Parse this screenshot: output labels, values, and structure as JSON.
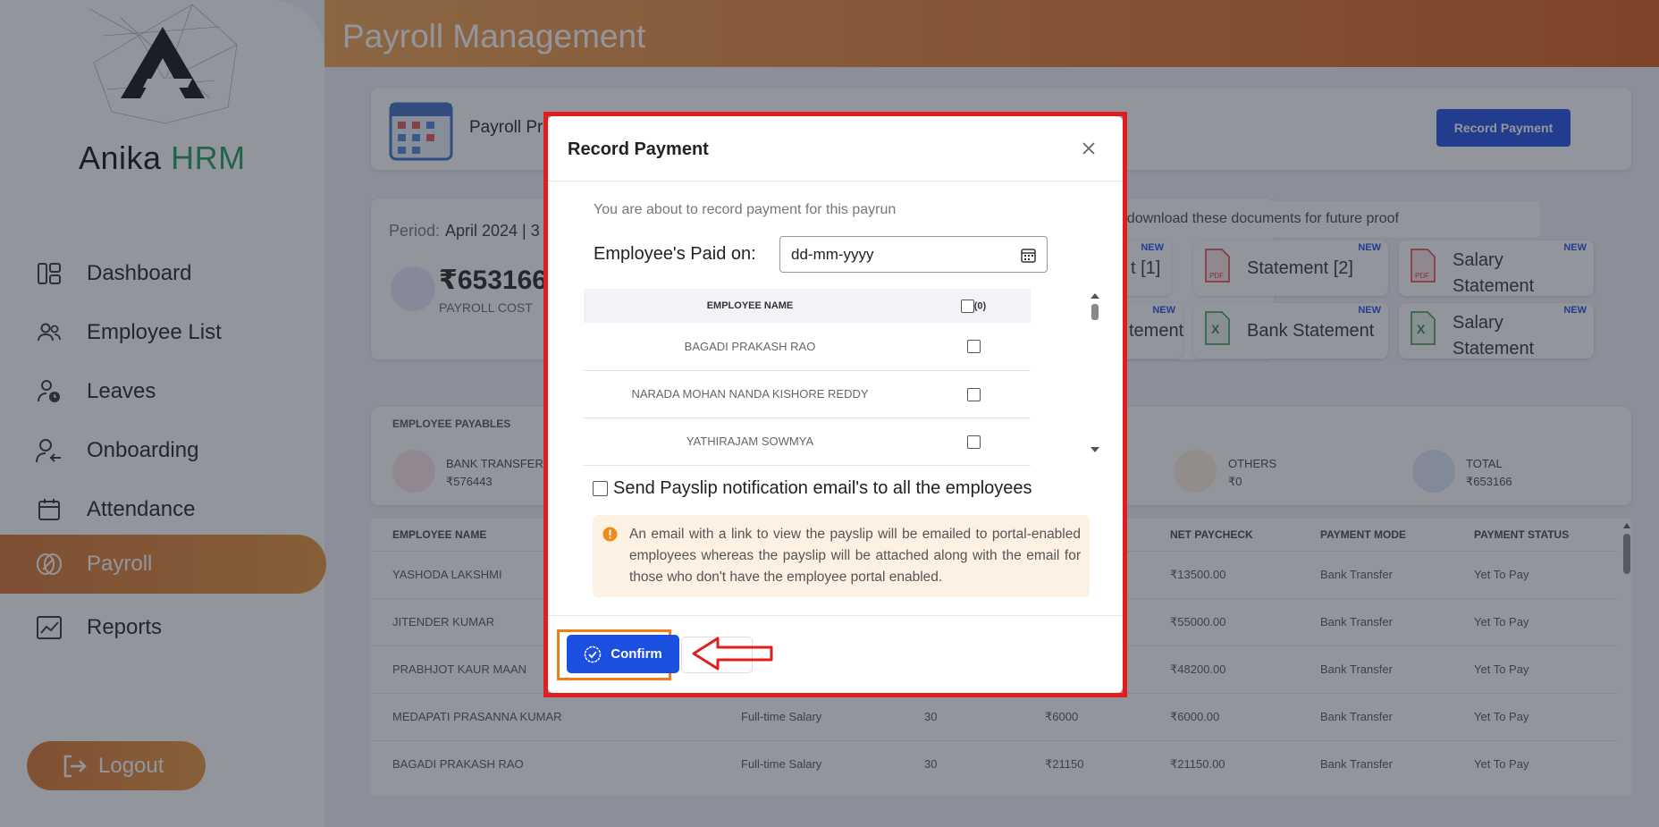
{
  "app": {
    "brand_part1": "Anika",
    "brand_part2": "HRM",
    "page_title": "Payroll Management"
  },
  "sidebar": {
    "items": [
      {
        "label": "Dashboard"
      },
      {
        "label": "Employee List"
      },
      {
        "label": "Leaves"
      },
      {
        "label": "Onboarding"
      },
      {
        "label": "Attendance"
      },
      {
        "label": "Payroll"
      },
      {
        "label": "Reports"
      }
    ],
    "logout": "Logout"
  },
  "payroll_header": {
    "label": "Payroll Pr",
    "record_payment": "Record Payment"
  },
  "period": {
    "text": "Period:",
    "value": "April 2024 | 3",
    "cost": "₹653166",
    "cost_label": "PAYROLL COST",
    "download_note": "l to download these documents for future proof"
  },
  "doc_tiles": [
    {
      "label": "t [1]",
      "new": "NEW"
    },
    {
      "label": "Statement [2]",
      "new": "NEW"
    },
    {
      "label": "Salary Statement",
      "new": "NEW"
    },
    {
      "label": "tement",
      "new": "NEW"
    },
    {
      "label": "Bank Statement",
      "new": "NEW"
    },
    {
      "label": "Salary Statement",
      "new": "NEW"
    }
  ],
  "payables": {
    "title": "EMPLOYEE PAYABLES",
    "bank_transfer": "BANK TRANSFER",
    "bank_transfer_value": "₹576443",
    "others": "OTHERS",
    "others_value": "₹0",
    "total": "TOTAL",
    "total_value": "₹653166"
  },
  "table": {
    "headers": [
      "EMPLOYEE NAME",
      "NET PAYCHECK",
      "PAYMENT MODE",
      "PAYMENT STATUS"
    ],
    "rows": [
      {
        "name": "YASHODA LAKSHMI",
        "type": "",
        "days": "",
        "gross": "",
        "net": "₹13500.00",
        "mode": "Bank Transfer",
        "status": "Yet To Pay"
      },
      {
        "name": "JITENDER KUMAR",
        "type": "",
        "days": "",
        "gross": "",
        "net": "₹55000.00",
        "mode": "Bank Transfer",
        "status": "Yet To Pay"
      },
      {
        "name": "PRABHJOT KAUR MAAN",
        "type": "",
        "days": "",
        "gross": "",
        "net": "₹48200.00",
        "mode": "Bank Transfer",
        "status": "Yet To Pay"
      },
      {
        "name": "MEDAPATI PRASANNA KUMAR",
        "type": "Full-time Salary",
        "days": "30",
        "gross": "₹6000",
        "net": "₹6000.00",
        "mode": "Bank Transfer",
        "status": "Yet To Pay"
      },
      {
        "name": "BAGADI PRAKASH RAO",
        "type": "Full-time Salary",
        "days": "30",
        "gross": "₹21150",
        "net": "₹21150.00",
        "mode": "Bank Transfer",
        "status": "Yet To Pay"
      }
    ]
  },
  "modal": {
    "title": "Record Payment",
    "intro": "You are about to record payment for this payrun",
    "paid_on_label": "Employee's Paid on:",
    "date_placeholder": "dd-mm-yyyy",
    "col_name": "EMPLOYEE NAME",
    "col_count": "(0)",
    "employees": [
      "BAGADI PRAKASH RAO",
      "NARADA MOHAN NANDA KISHORE REDDY",
      "YATHIRAJAM SOWMYA"
    ],
    "send_label": "Send Payslip notification email's to all the employees",
    "info": "An email with a link to view the payslip will be emailed to portal-enabled employees whereas the payslip will be attached along with the email for those who don't have the employee portal enabled.",
    "confirm": "Confirm"
  }
}
